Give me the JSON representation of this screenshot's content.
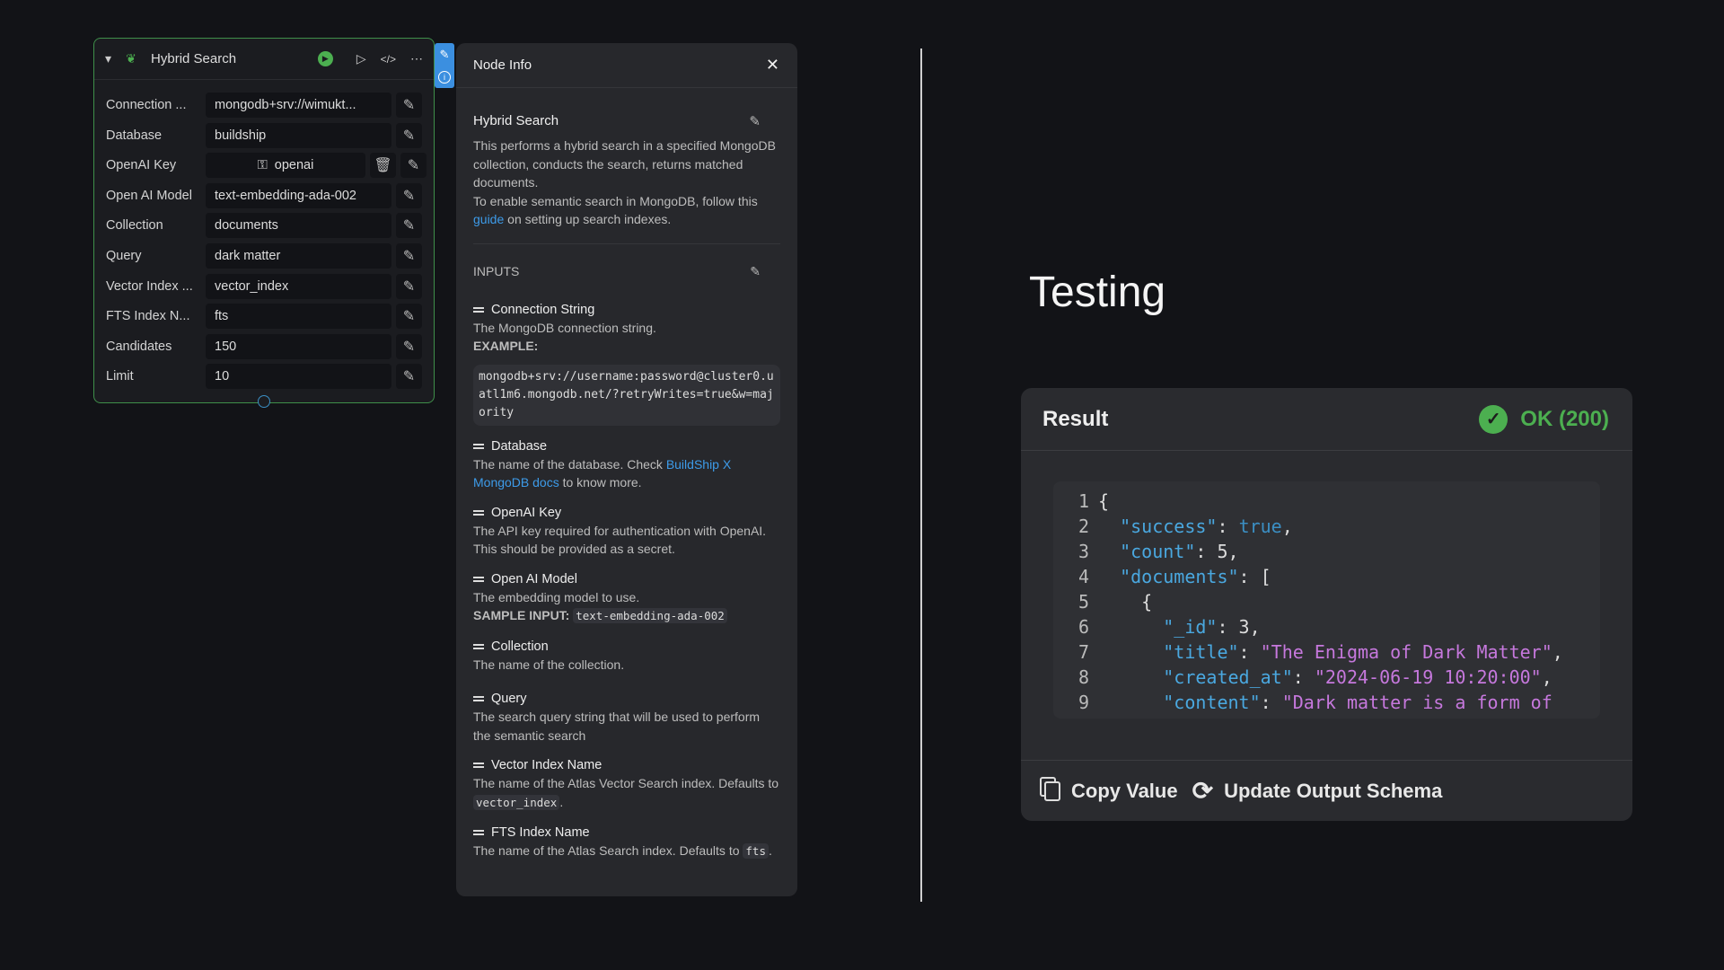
{
  "node": {
    "title": "Hybrid Search",
    "fields": [
      {
        "label": "Connection ...",
        "value": "mongodb+srv://wimukt..."
      },
      {
        "label": "Database",
        "value": "buildship"
      },
      {
        "label": "OpenAI Key",
        "value": "openai"
      },
      {
        "label": "Open AI Model",
        "value": "text-embedding-ada-002"
      },
      {
        "label": "Collection",
        "value": "documents"
      },
      {
        "label": "Query",
        "value": "dark matter"
      },
      {
        "label": "Vector Index ...",
        "value": "vector_index"
      },
      {
        "label": "FTS Index N...",
        "value": "fts"
      },
      {
        "label": "Candidates",
        "value": "150"
      },
      {
        "label": "Limit",
        "value": "10"
      }
    ]
  },
  "info": {
    "header": "Node Info",
    "title": "Hybrid Search",
    "desc1": "This performs a hybrid search in a specified MongoDB collection, conducts the search, returns matched documents.",
    "desc2a": "To enable semantic search in MongoDB, follow this ",
    "desc2link": "guide",
    "desc2b": " on setting up search indexes.",
    "inputs_label": "INPUTS",
    "conn": {
      "name": "Connection String",
      "desc": "The MongoDB connection string.",
      "example_label": "EXAMPLE:",
      "example": "mongodb+srv://username:password@cluster0.uatl1m6.mongodb.net/?retryWrites=true&w=majority"
    },
    "db": {
      "name": "Database",
      "desc_a": "The name of the database. Check ",
      "link": "BuildShip X MongoDB docs",
      "desc_b": " to know more."
    },
    "key": {
      "name": "OpenAI Key",
      "desc": "The API key required for authentication with OpenAI. This should be provided as a secret."
    },
    "model": {
      "name": "Open AI Model",
      "desc": "The embedding model to use.",
      "sample_label": "SAMPLE INPUT:",
      "sample": "text-embedding-ada-002"
    },
    "collection": {
      "name": "Collection",
      "desc": "The name of the collection."
    },
    "query": {
      "name": "Query",
      "desc": "The search query string that will be used to perform the semantic search"
    },
    "vector": {
      "name": "Vector Index Name",
      "desc": "The name of the Atlas Vector Search index. Defaults to ",
      "code": "vector_index",
      "end": "."
    },
    "fts": {
      "name": "FTS Index Name",
      "desc": "The name of the Atlas Search index. Defaults to ",
      "code": "fts",
      "end": "."
    }
  },
  "testing": {
    "heading": "Testing"
  },
  "result": {
    "title": "Result",
    "status": "OK (200)",
    "copy": "Copy Value",
    "update": "Update Output Schema",
    "lines": [
      [
        [
          "p",
          "{"
        ]
      ],
      [
        [
          "p",
          "  "
        ],
        [
          "k",
          "\"success\""
        ],
        [
          "p",
          ": "
        ],
        [
          "b",
          "true"
        ],
        [
          "p",
          ","
        ]
      ],
      [
        [
          "p",
          "  "
        ],
        [
          "k",
          "\"count\""
        ],
        [
          "p",
          ": 5,"
        ]
      ],
      [
        [
          "p",
          "  "
        ],
        [
          "k",
          "\"documents\""
        ],
        [
          "p",
          ": ["
        ]
      ],
      [
        [
          "p",
          "    {"
        ]
      ],
      [
        [
          "p",
          "      "
        ],
        [
          "k",
          "\"_id\""
        ],
        [
          "p",
          ": 3,"
        ]
      ],
      [
        [
          "p",
          "      "
        ],
        [
          "k",
          "\"title\""
        ],
        [
          "p",
          ": "
        ],
        [
          "s",
          "\"The Enigma of Dark Matter\""
        ],
        [
          "p",
          ","
        ]
      ],
      [
        [
          "p",
          "      "
        ],
        [
          "k",
          "\"created_at\""
        ],
        [
          "p",
          ": "
        ],
        [
          "s",
          "\"2024-06-19 10:20:00\""
        ],
        [
          "p",
          ","
        ]
      ],
      [
        [
          "p",
          "      "
        ],
        [
          "k",
          "\"content\""
        ],
        [
          "p",
          ": "
        ],
        [
          "s",
          "\"Dark matter is a form of"
        ]
      ]
    ]
  },
  "colors": {
    "accent": "#3d9be9",
    "ok": "#4caf50",
    "border": "#3f8f4a"
  }
}
